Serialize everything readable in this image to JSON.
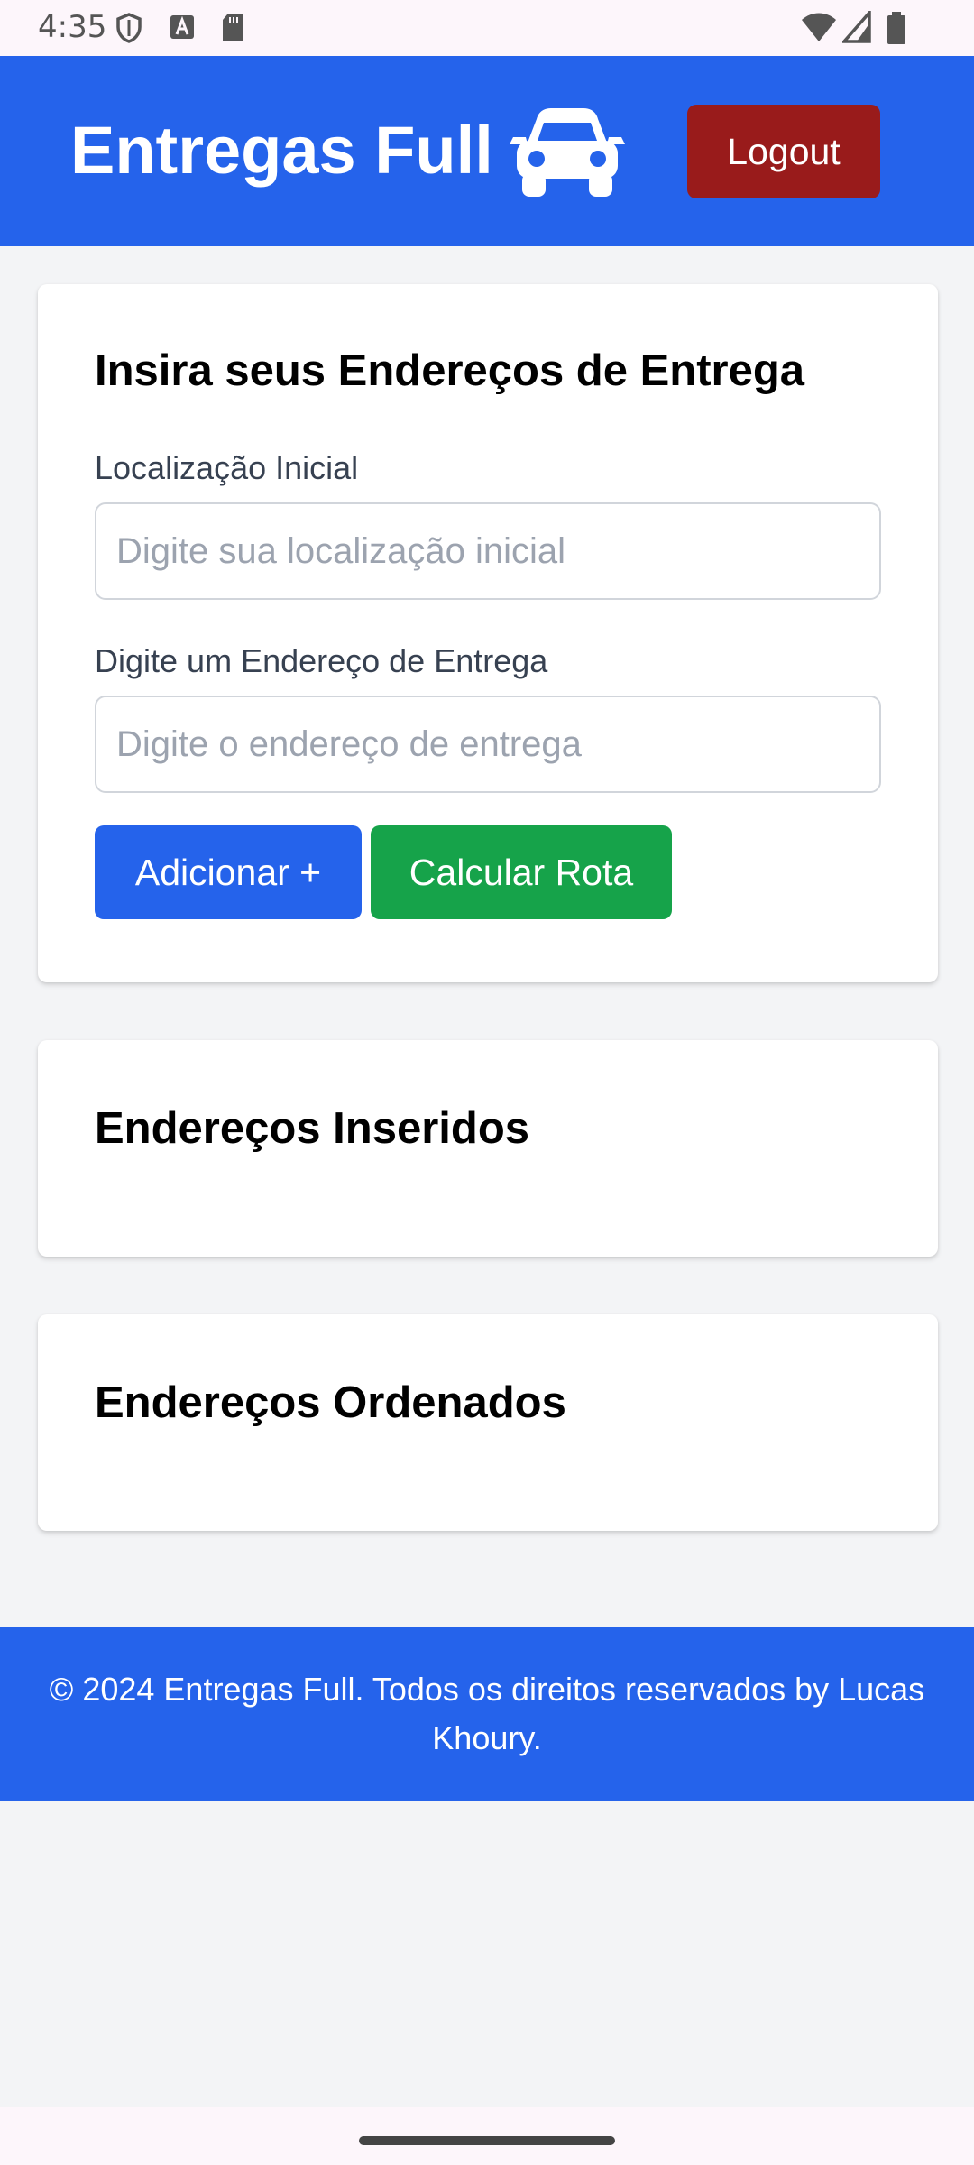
{
  "status_bar": {
    "time": "4:35",
    "left_icons": [
      "shield-icon",
      "font-a-icon",
      "sd-card-icon"
    ],
    "right_icons": [
      "wifi-icon",
      "signal-icon",
      "battery-icon"
    ]
  },
  "header": {
    "title": "Entregas Full",
    "icon": "car-icon",
    "logout_label": "Logout",
    "colors": {
      "background": "#2563eb",
      "logout": "#991b1b"
    }
  },
  "address_form": {
    "title": "Insira seus Endereços de Entrega",
    "initial_location": {
      "label": "Localização Inicial",
      "value": "",
      "placeholder": "Digite sua localização inicial"
    },
    "delivery_address": {
      "label": "Digite um Endereço de Entrega",
      "value": "",
      "placeholder": "Digite o endereço de entrega"
    },
    "add_button_label": "Adicionar +",
    "calculate_button_label": "Calcular Rota",
    "colors": {
      "add": "#2563eb",
      "calculate": "#16a34a"
    }
  },
  "inserted_addresses": {
    "title": "Endereços Inseridos",
    "items": []
  },
  "ordered_addresses": {
    "title": "Endereços Ordenados",
    "items": []
  },
  "footer": {
    "text": "© 2024 Entregas Full. Todos os direitos reservados by Lucas Khoury."
  }
}
